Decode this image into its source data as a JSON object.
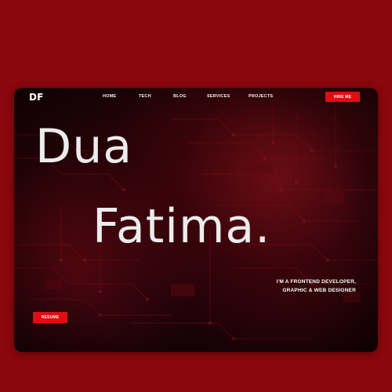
{
  "site": {
    "logo": "DF"
  },
  "nav": {
    "items": [
      {
        "label": "HOME"
      },
      {
        "label": "TECH"
      },
      {
        "label": "BLOG"
      },
      {
        "label": "SERVICES"
      },
      {
        "label": "PROJECTS"
      }
    ],
    "hire_label": "HIRE ME"
  },
  "hero": {
    "first_name": "Dua",
    "last_name": "Fatima.",
    "tagline_line1": "I'M A FRONTEND DEVELOPER,",
    "tagline_line2": "GRAPHIC & WEB DESIGNER",
    "resume_label": "RESUME"
  },
  "colors": {
    "page_background": "#8a070c",
    "accent": "#e00e12",
    "hero_text": "#ececec"
  }
}
